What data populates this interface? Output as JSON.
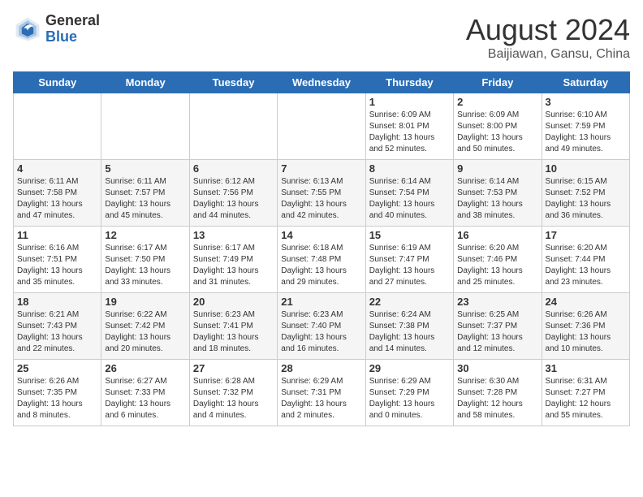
{
  "header": {
    "logo": {
      "general": "General",
      "blue": "Blue"
    },
    "title": "August 2024",
    "location": "Baijiawan, Gansu, China"
  },
  "weekdays": [
    "Sunday",
    "Monday",
    "Tuesday",
    "Wednesday",
    "Thursday",
    "Friday",
    "Saturday"
  ],
  "weeks": [
    [
      {
        "day": "",
        "info": ""
      },
      {
        "day": "",
        "info": ""
      },
      {
        "day": "",
        "info": ""
      },
      {
        "day": "",
        "info": ""
      },
      {
        "day": "1",
        "info": "Sunrise: 6:09 AM\nSunset: 8:01 PM\nDaylight: 13 hours\nand 52 minutes."
      },
      {
        "day": "2",
        "info": "Sunrise: 6:09 AM\nSunset: 8:00 PM\nDaylight: 13 hours\nand 50 minutes."
      },
      {
        "day": "3",
        "info": "Sunrise: 6:10 AM\nSunset: 7:59 PM\nDaylight: 13 hours\nand 49 minutes."
      }
    ],
    [
      {
        "day": "4",
        "info": "Sunrise: 6:11 AM\nSunset: 7:58 PM\nDaylight: 13 hours\nand 47 minutes."
      },
      {
        "day": "5",
        "info": "Sunrise: 6:11 AM\nSunset: 7:57 PM\nDaylight: 13 hours\nand 45 minutes."
      },
      {
        "day": "6",
        "info": "Sunrise: 6:12 AM\nSunset: 7:56 PM\nDaylight: 13 hours\nand 44 minutes."
      },
      {
        "day": "7",
        "info": "Sunrise: 6:13 AM\nSunset: 7:55 PM\nDaylight: 13 hours\nand 42 minutes."
      },
      {
        "day": "8",
        "info": "Sunrise: 6:14 AM\nSunset: 7:54 PM\nDaylight: 13 hours\nand 40 minutes."
      },
      {
        "day": "9",
        "info": "Sunrise: 6:14 AM\nSunset: 7:53 PM\nDaylight: 13 hours\nand 38 minutes."
      },
      {
        "day": "10",
        "info": "Sunrise: 6:15 AM\nSunset: 7:52 PM\nDaylight: 13 hours\nand 36 minutes."
      }
    ],
    [
      {
        "day": "11",
        "info": "Sunrise: 6:16 AM\nSunset: 7:51 PM\nDaylight: 13 hours\nand 35 minutes."
      },
      {
        "day": "12",
        "info": "Sunrise: 6:17 AM\nSunset: 7:50 PM\nDaylight: 13 hours\nand 33 minutes."
      },
      {
        "day": "13",
        "info": "Sunrise: 6:17 AM\nSunset: 7:49 PM\nDaylight: 13 hours\nand 31 minutes."
      },
      {
        "day": "14",
        "info": "Sunrise: 6:18 AM\nSunset: 7:48 PM\nDaylight: 13 hours\nand 29 minutes."
      },
      {
        "day": "15",
        "info": "Sunrise: 6:19 AM\nSunset: 7:47 PM\nDaylight: 13 hours\nand 27 minutes."
      },
      {
        "day": "16",
        "info": "Sunrise: 6:20 AM\nSunset: 7:46 PM\nDaylight: 13 hours\nand 25 minutes."
      },
      {
        "day": "17",
        "info": "Sunrise: 6:20 AM\nSunset: 7:44 PM\nDaylight: 13 hours\nand 23 minutes."
      }
    ],
    [
      {
        "day": "18",
        "info": "Sunrise: 6:21 AM\nSunset: 7:43 PM\nDaylight: 13 hours\nand 22 minutes."
      },
      {
        "day": "19",
        "info": "Sunrise: 6:22 AM\nSunset: 7:42 PM\nDaylight: 13 hours\nand 20 minutes."
      },
      {
        "day": "20",
        "info": "Sunrise: 6:23 AM\nSunset: 7:41 PM\nDaylight: 13 hours\nand 18 minutes."
      },
      {
        "day": "21",
        "info": "Sunrise: 6:23 AM\nSunset: 7:40 PM\nDaylight: 13 hours\nand 16 minutes."
      },
      {
        "day": "22",
        "info": "Sunrise: 6:24 AM\nSunset: 7:38 PM\nDaylight: 13 hours\nand 14 minutes."
      },
      {
        "day": "23",
        "info": "Sunrise: 6:25 AM\nSunset: 7:37 PM\nDaylight: 13 hours\nand 12 minutes."
      },
      {
        "day": "24",
        "info": "Sunrise: 6:26 AM\nSunset: 7:36 PM\nDaylight: 13 hours\nand 10 minutes."
      }
    ],
    [
      {
        "day": "25",
        "info": "Sunrise: 6:26 AM\nSunset: 7:35 PM\nDaylight: 13 hours\nand 8 minutes."
      },
      {
        "day": "26",
        "info": "Sunrise: 6:27 AM\nSunset: 7:33 PM\nDaylight: 13 hours\nand 6 minutes."
      },
      {
        "day": "27",
        "info": "Sunrise: 6:28 AM\nSunset: 7:32 PM\nDaylight: 13 hours\nand 4 minutes."
      },
      {
        "day": "28",
        "info": "Sunrise: 6:29 AM\nSunset: 7:31 PM\nDaylight: 13 hours\nand 2 minutes."
      },
      {
        "day": "29",
        "info": "Sunrise: 6:29 AM\nSunset: 7:29 PM\nDaylight: 13 hours\nand 0 minutes."
      },
      {
        "day": "30",
        "info": "Sunrise: 6:30 AM\nSunset: 7:28 PM\nDaylight: 12 hours\nand 58 minutes."
      },
      {
        "day": "31",
        "info": "Sunrise: 6:31 AM\nSunset: 7:27 PM\nDaylight: 12 hours\nand 55 minutes."
      }
    ]
  ]
}
